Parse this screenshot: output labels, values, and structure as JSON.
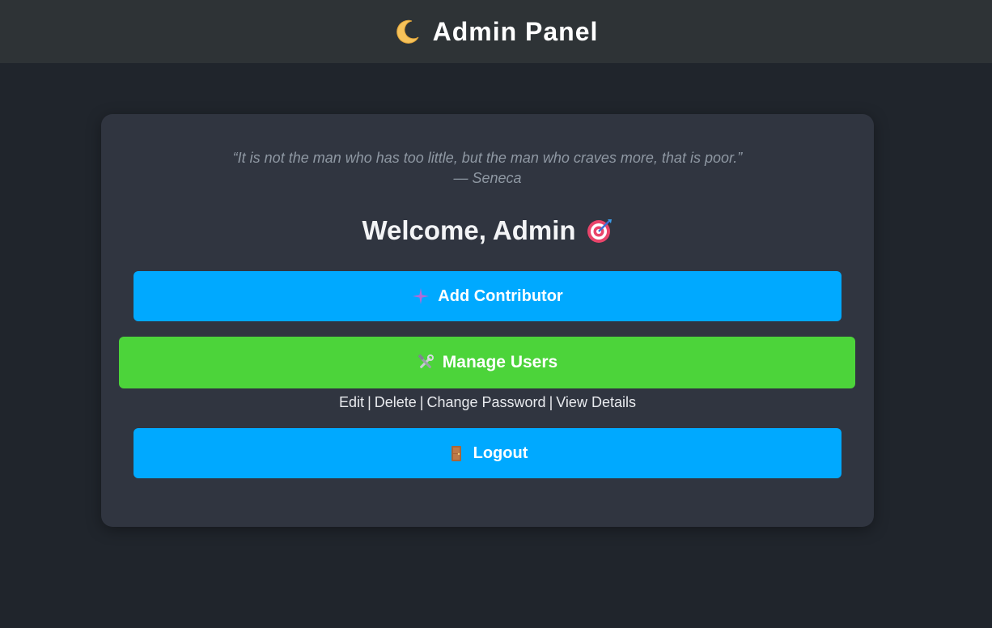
{
  "header": {
    "title": "Admin Panel",
    "icon": "crescent-moon-icon"
  },
  "quote": {
    "text": "“It is not the man who has too little, but the man who craves more, that is poor.”",
    "author": "— Seneca"
  },
  "welcome": {
    "text": "Welcome, Admin",
    "icon": "target-icon"
  },
  "actions": {
    "add_contributor": {
      "label": "Add Contributor",
      "icon": "sparkle-icon",
      "color": "#00a9ff"
    },
    "manage_users": {
      "label": "Manage Users",
      "icon": "tools-icon",
      "color": "#4cd43a"
    },
    "manage_links": [
      {
        "label": "Edit"
      },
      {
        "label": "Delete"
      },
      {
        "label": "Change Password"
      },
      {
        "label": "View Details"
      }
    ],
    "separator": "|",
    "logout": {
      "label": "Logout",
      "icon": "door-icon",
      "color": "#00a9ff"
    }
  }
}
